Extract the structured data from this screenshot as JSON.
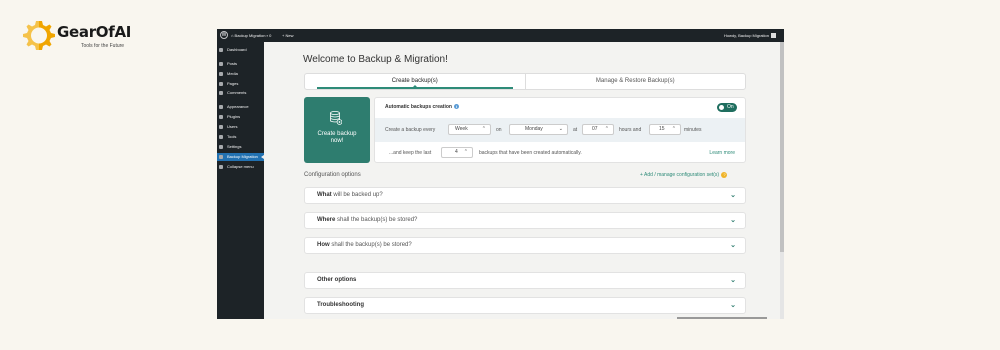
{
  "brand": {
    "name": "GearOfAI",
    "tagline": "Tools for the Future",
    "accent_color": "#f0a500"
  },
  "adminbar": {
    "site_name": "Backup Migration",
    "comment_count": "0",
    "new_label": "New",
    "howdy": "Howdy, Backup Migration"
  },
  "sidebar": {
    "items": [
      {
        "label": "Dashboard",
        "icon": "dashboard-icon"
      },
      {
        "label": "Posts",
        "icon": "pin-icon"
      },
      {
        "label": "Media",
        "icon": "media-icon"
      },
      {
        "label": "Pages",
        "icon": "pages-icon"
      },
      {
        "label": "Comments",
        "icon": "comment-icon"
      },
      {
        "label": "Appearance",
        "icon": "brush-icon"
      },
      {
        "label": "Plugins",
        "icon": "plugin-icon"
      },
      {
        "label": "Users",
        "icon": "user-icon"
      },
      {
        "label": "Tools",
        "icon": "wrench-icon"
      },
      {
        "label": "Settings",
        "icon": "settings-icon"
      },
      {
        "label": "Backup Migration",
        "icon": "backup-icon",
        "active": true
      },
      {
        "label": "Collapse menu",
        "icon": "collapse-icon"
      }
    ]
  },
  "main": {
    "title": "Welcome to Backup & Migration!",
    "tabs": [
      {
        "label": "Create backup(s)",
        "selected": true
      },
      {
        "label": "Manage & Restore Backup(s)",
        "selected": false
      }
    ],
    "create_button": {
      "line1": "Create backup",
      "line2": "now!"
    },
    "auto": {
      "label": "Automatic backups creation",
      "toggle_label": "On",
      "every_prefix": "Create a backup every",
      "frequency": "Week",
      "on_label": "on",
      "day": "Monday",
      "at_label": "at",
      "hour": "07",
      "hours_and": "hours and",
      "minute": "15",
      "minutes_label": "minutes",
      "keep_prefix": "...and keep the last",
      "keep_count": "4",
      "keep_suffix": "backups that have been created automatically.",
      "learn_more": "Learn more"
    },
    "config": {
      "label": "Configuration options",
      "add_link": "+ Add / manage configuration set(s)",
      "add_help": "?"
    },
    "accordions": [
      {
        "bold": "What",
        "rest": " will be backed up?"
      },
      {
        "bold": "Where",
        "rest": " shall the backup(s) be stored?"
      },
      {
        "bold": "How",
        "rest": " shall the backup(s) be stored?"
      },
      {
        "bold": "Other options",
        "rest": ""
      },
      {
        "bold": "Troubleshooting",
        "rest": ""
      }
    ],
    "colors": {
      "primary": "#2e7d6f",
      "wp_admin_bg": "#1d2327",
      "wp_active": "#2271b1"
    }
  }
}
